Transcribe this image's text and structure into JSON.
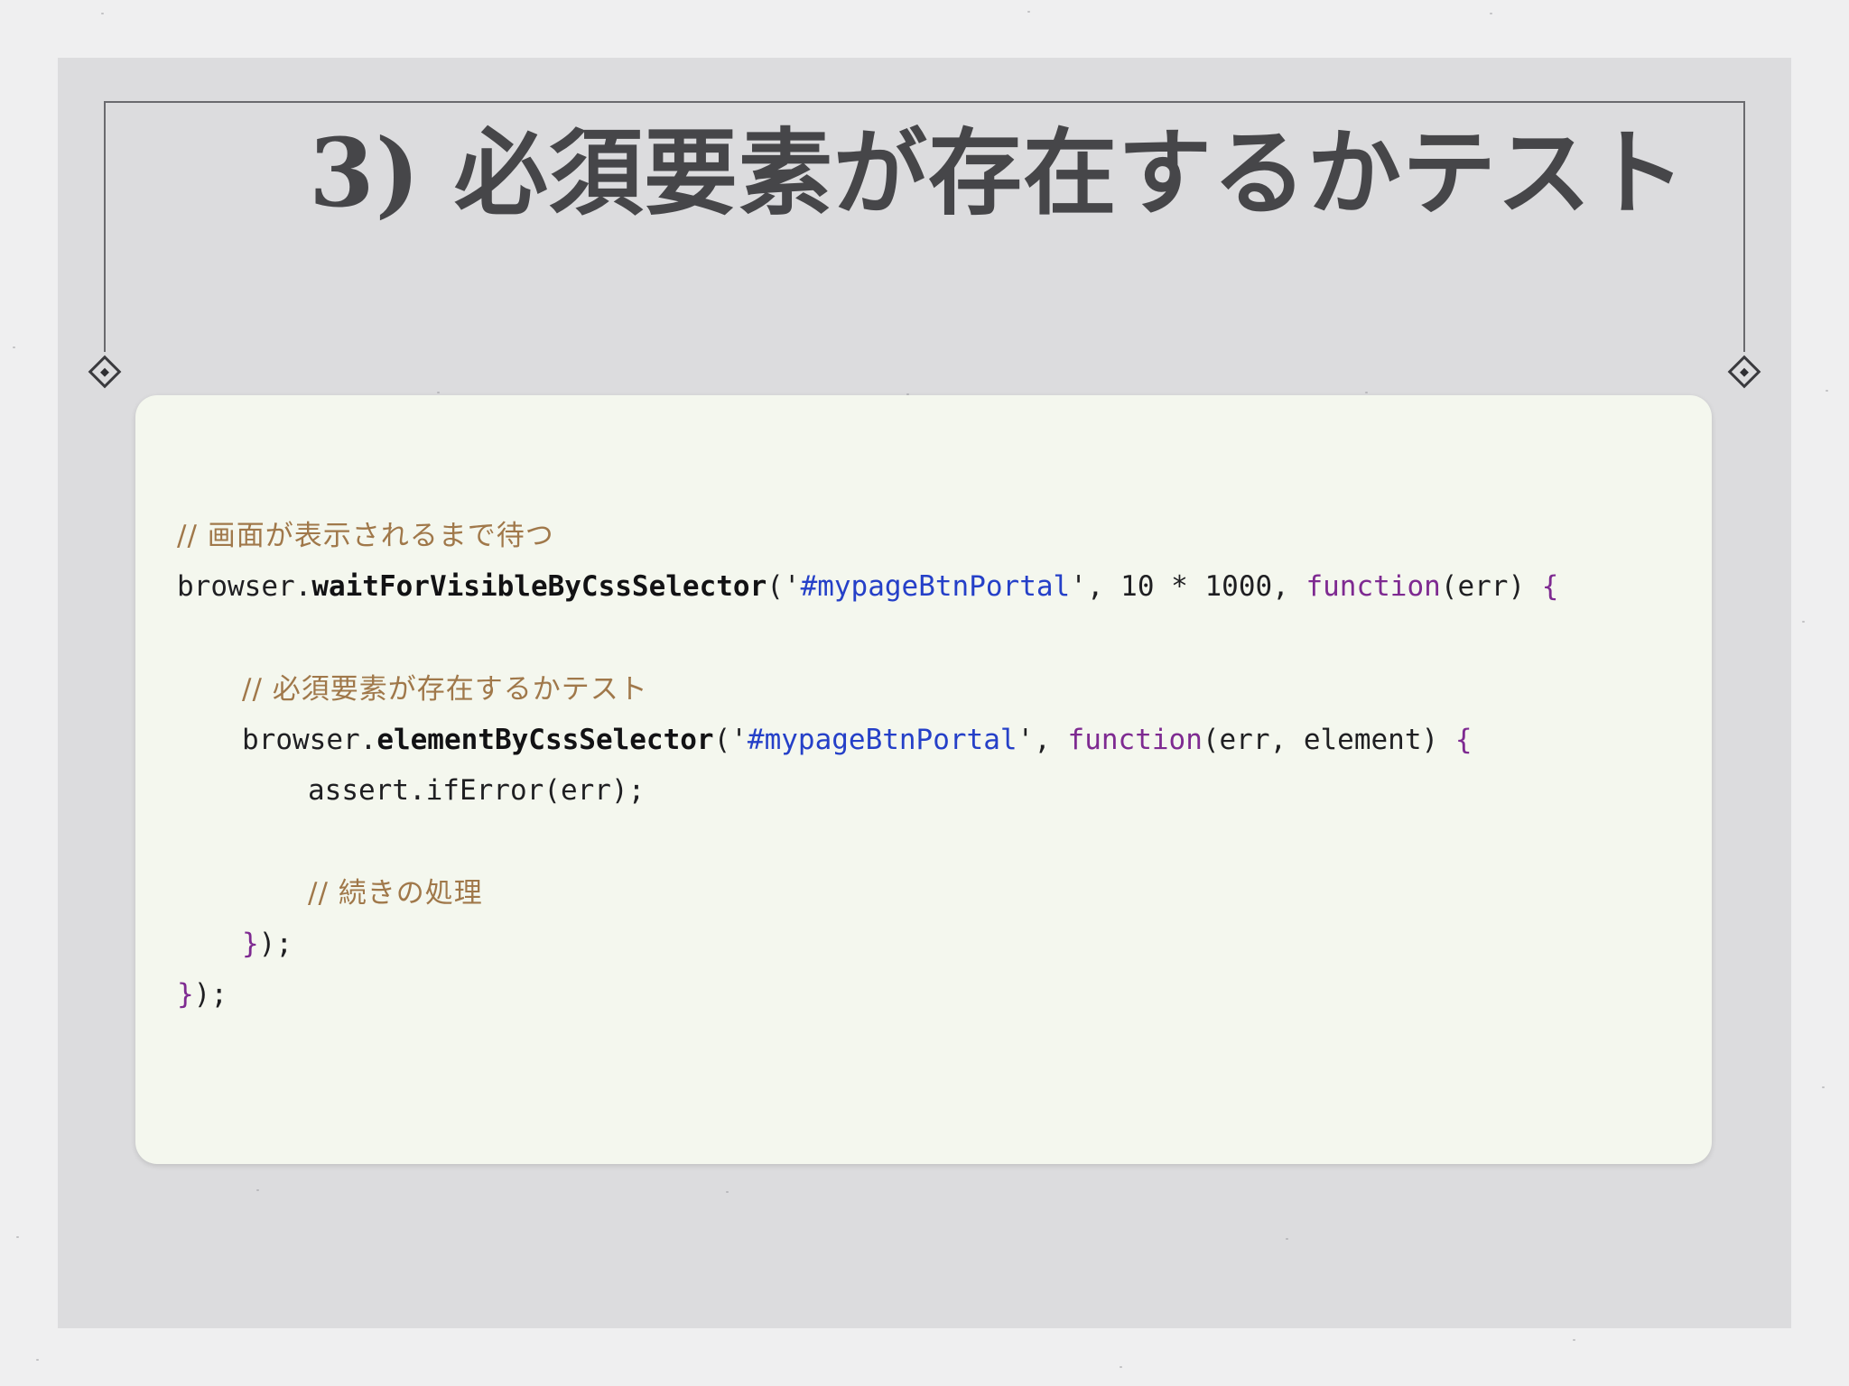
{
  "slide": {
    "title": "3) 必須要素が存在するかテスト"
  },
  "code": {
    "line1": {
      "comment": "// 画面が表示されるまで待つ"
    },
    "line2": {
      "obj": "browser.",
      "method": "waitForVisibleByCssSelector",
      "open": "('",
      "string": "#mypageBtnPortal",
      "mid": "', 10 * 1000, ",
      "keyword": "function",
      "args": "(err) ",
      "brace": "{"
    },
    "line3": {
      "comment": "// 必須要素が存在するかテスト"
    },
    "line4": {
      "obj": "browser.",
      "method": "elementByCssSelector",
      "open": "('",
      "string": "#mypageBtnPortal",
      "mid": "', ",
      "keyword": "function",
      "args": "(err, element) ",
      "brace": "{"
    },
    "line5": {
      "text": "assert.ifError(err);"
    },
    "line6": {
      "comment": "// 続きの処理"
    },
    "line7": {
      "brace": "}",
      "rest": ");"
    },
    "line8": {
      "brace": "}",
      "rest": ");"
    }
  }
}
